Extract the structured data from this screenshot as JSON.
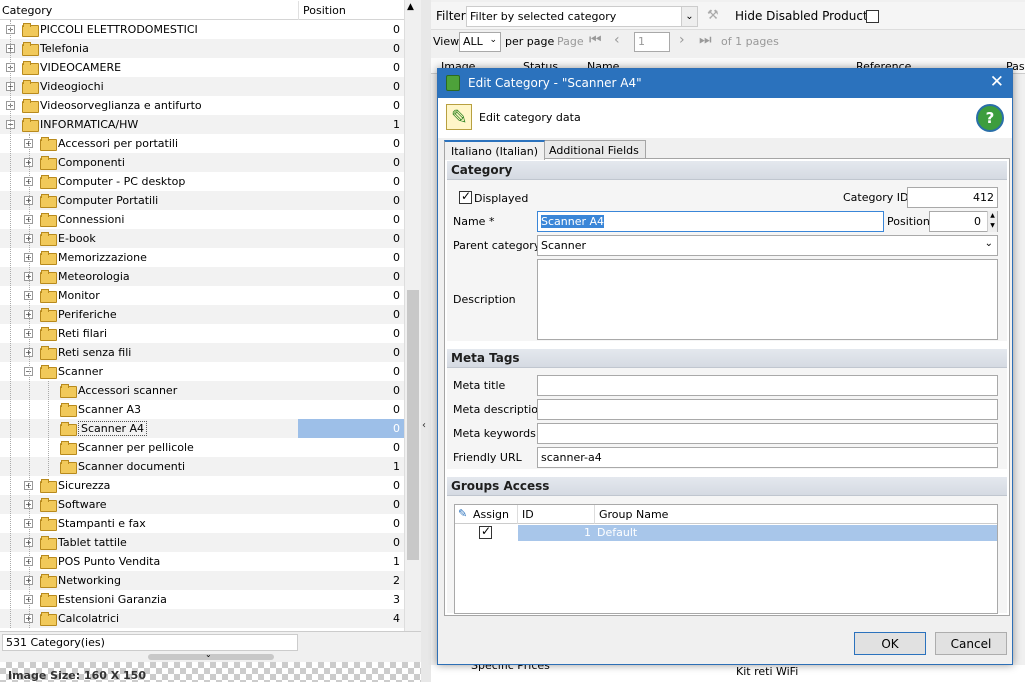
{
  "tree": {
    "col_category": "Category",
    "col_position": "Position",
    "rows": [
      {
        "label": "PICCOLI ELETTRODOMESTICI",
        "pos": "0",
        "level": 0,
        "exp": "+"
      },
      {
        "label": "Telefonia",
        "pos": "0",
        "level": 0,
        "exp": "+"
      },
      {
        "label": "VIDEOCAMERE",
        "pos": "0",
        "level": 0,
        "exp": "+"
      },
      {
        "label": "Videogiochi",
        "pos": "0",
        "level": 0,
        "exp": "+"
      },
      {
        "label": "Videosorveglianza e antifurto",
        "pos": "0",
        "level": 0,
        "exp": "+"
      },
      {
        "label": "INFORMATICA/HW",
        "pos": "1",
        "level": 0,
        "exp": "−"
      },
      {
        "label": "Accessori per portatili",
        "pos": "0",
        "level": 1,
        "exp": "+"
      },
      {
        "label": "Componenti",
        "pos": "0",
        "level": 1,
        "exp": "+"
      },
      {
        "label": "Computer - PC desktop",
        "pos": "0",
        "level": 1,
        "exp": "+"
      },
      {
        "label": "Computer Portatili",
        "pos": "0",
        "level": 1,
        "exp": "+"
      },
      {
        "label": "Connessioni",
        "pos": "0",
        "level": 1,
        "exp": "+"
      },
      {
        "label": "E-book",
        "pos": "0",
        "level": 1,
        "exp": "+"
      },
      {
        "label": "Memorizzazione",
        "pos": "0",
        "level": 1,
        "exp": "+"
      },
      {
        "label": "Meteorologia",
        "pos": "0",
        "level": 1,
        "exp": "+"
      },
      {
        "label": "Monitor",
        "pos": "0",
        "level": 1,
        "exp": "+"
      },
      {
        "label": "Periferiche",
        "pos": "0",
        "level": 1,
        "exp": "+"
      },
      {
        "label": "Reti filari",
        "pos": "0",
        "level": 1,
        "exp": "+"
      },
      {
        "label": "Reti senza fili",
        "pos": "0",
        "level": 1,
        "exp": "+"
      },
      {
        "label": "Scanner",
        "pos": "0",
        "level": 1,
        "exp": "−"
      },
      {
        "label": "Accessori scanner",
        "pos": "0",
        "level": 2,
        "exp": ""
      },
      {
        "label": "Scanner A3",
        "pos": "0",
        "level": 2,
        "exp": ""
      },
      {
        "label": "Scanner A4",
        "pos": "0",
        "level": 2,
        "exp": "",
        "selected": true
      },
      {
        "label": "Scanner per pellicole",
        "pos": "0",
        "level": 2,
        "exp": ""
      },
      {
        "label": "Scanner documenti",
        "pos": "1",
        "level": 2,
        "exp": ""
      },
      {
        "label": "Sicurezza",
        "pos": "0",
        "level": 1,
        "exp": "+"
      },
      {
        "label": "Software",
        "pos": "0",
        "level": 1,
        "exp": "+"
      },
      {
        "label": "Stampanti e fax",
        "pos": "0",
        "level": 1,
        "exp": "+"
      },
      {
        "label": "Tablet tattile",
        "pos": "0",
        "level": 1,
        "exp": "+"
      },
      {
        "label": "POS Punto Vendita",
        "pos": "1",
        "level": 1,
        "exp": "+"
      },
      {
        "label": "Networking",
        "pos": "2",
        "level": 1,
        "exp": "+"
      },
      {
        "label": "Estensioni Garanzia",
        "pos": "3",
        "level": 1,
        "exp": "+"
      },
      {
        "label": "Calcolatrici",
        "pos": "4",
        "level": 1,
        "exp": "+"
      }
    ],
    "count_text": "531 Category(ies)",
    "image_size": "Image Size: 160 X 150"
  },
  "toolbar": {
    "filter_label": "Filter",
    "filter_value": "Filter by selected category",
    "hide_disabled": "Hide Disabled Products",
    "view_label": "View",
    "view_value": "ALL",
    "per_page": "per page",
    "page_label": "Page",
    "page_value": "1",
    "of_pages": "of 1 pages"
  },
  "dialog": {
    "title": "Edit Category - \"Scanner A4\"",
    "subtitle": "Edit category data",
    "tabs": [
      "Italiano (Italian)",
      "Additional Fields"
    ],
    "category_section": "Category",
    "displayed_label": "Displayed",
    "category_id_label": "Category ID",
    "category_id": "412",
    "name_label": "Name *",
    "name_value": "Scanner A4",
    "position_label": "Position",
    "position_value": "0",
    "parent_label": "Parent category",
    "parent_value": "Scanner",
    "description_label": "Description",
    "meta_section": "Meta Tags",
    "meta_title_label": "Meta title",
    "meta_desc_label": "Meta description",
    "meta_keywords_label": "Meta keywords",
    "friendly_url_label": "Friendly URL",
    "friendly_url_value": "scanner-a4",
    "groups_section": "Groups Access",
    "grid_assign": "Assign",
    "grid_id": "ID",
    "grid_group": "Group Name",
    "group_id": "1",
    "group_name": "Default",
    "ok": "OK",
    "cancel": "Cancel"
  },
  "background": {
    "col_image": "Image",
    "col_status": "Status",
    "col_name": "Name",
    "col_reference": "Reference",
    "col_pas": "Pas",
    "specific_prices": "Specific Prices",
    "kit_reti": "Kit reti WiFi"
  }
}
